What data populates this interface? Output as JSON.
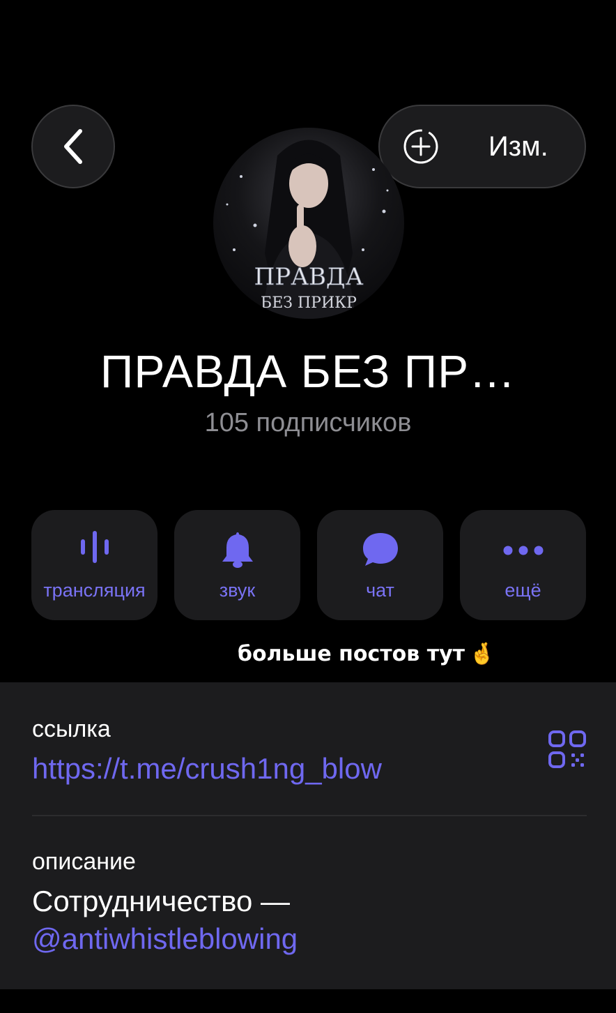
{
  "header": {
    "edit_label": "Изм."
  },
  "channel": {
    "title": "ПРАВДА БЕЗ ПР…",
    "subscribers": "105 подписчиков",
    "avatar_caption_line1": "ПРАВДА",
    "avatar_caption_line2": "БЕЗ ПРИКР"
  },
  "actions": [
    {
      "label": "трансляция",
      "icon": "live-stream-icon"
    },
    {
      "label": "звук",
      "icon": "bell-icon"
    },
    {
      "label": "чат",
      "icon": "chat-bubble-icon"
    },
    {
      "label": "ещё",
      "icon": "more-dots-icon"
    }
  ],
  "promo": {
    "text": "больше постов тут",
    "emoji": "🤞"
  },
  "info": {
    "link_label": "ссылка",
    "link_value": "https://t.me/crush1ng_blow",
    "description_label": "описание",
    "description_text": "Сотрудничество —",
    "description_mention": "@antiwhistleblowing"
  },
  "colors": {
    "accent": "#6f68f0",
    "background": "#000000",
    "card": "#1c1c1e",
    "muted_text": "#8e8e93"
  }
}
